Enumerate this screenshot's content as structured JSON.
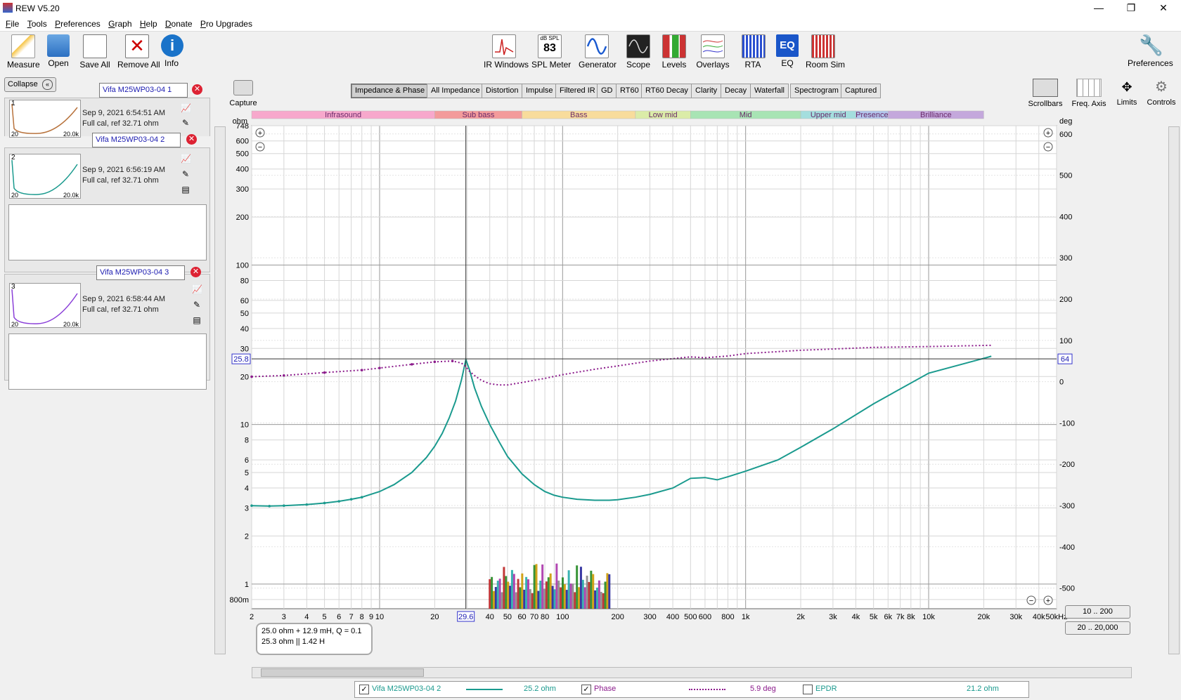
{
  "window": {
    "title": "REW V5.20",
    "minimize": "—",
    "maximize": "❐",
    "close": "✕"
  },
  "menu": [
    "File",
    "Tools",
    "Preferences",
    "Graph",
    "Help",
    "Donate",
    "Pro Upgrades"
  ],
  "toolbar_left": [
    {
      "label": "Measure",
      "icon": "measure-icon"
    },
    {
      "label": "Open",
      "icon": "folder-icon"
    },
    {
      "label": "Save All",
      "icon": "save-icon"
    },
    {
      "label": "Remove All",
      "icon": "remove-icon"
    },
    {
      "label": "Info",
      "icon": "info-icon"
    }
  ],
  "toolbar_center": [
    {
      "label": "IR Windows"
    },
    {
      "label": "SPL Meter",
      "display_top": "dB SPL",
      "display_value": "83"
    },
    {
      "label": "Generator"
    },
    {
      "label": "Scope"
    },
    {
      "label": "Levels"
    },
    {
      "label": "Overlays"
    },
    {
      "label": "RTA"
    },
    {
      "label": "EQ",
      "display_value": "EQ"
    },
    {
      "label": "Room Sim"
    }
  ],
  "toolbar_right": {
    "label": "Preferences"
  },
  "collapse": {
    "label": "Collapse",
    "icon": "«"
  },
  "measurements": [
    {
      "name": "Vifa M25WP03-04 1",
      "index": "1",
      "date": "Sep 9, 2021 6:54:51 AM",
      "cal": "Full cal, ref 32.71 ohm",
      "thumb_lo": "20",
      "thumb_hi": "20.0k",
      "color": "#b8733d"
    },
    {
      "name": "Vifa M25WP03-04 2",
      "index": "2",
      "date": "Sep 9, 2021 6:56:19 AM",
      "cal": "Full cal, ref 32.71 ohm",
      "thumb_lo": "20",
      "thumb_hi": "20.0k",
      "color": "#1a9a8e"
    },
    {
      "name": "Vifa M25WP03-04 3",
      "index": "3",
      "date": "Sep 9, 2021 6:58:44 AM",
      "cal": "Full cal, ref 32.71 ohm",
      "thumb_lo": "20",
      "thumb_hi": "20.0k",
      "color": "#8a3fd8"
    }
  ],
  "capture": {
    "label": "Capture"
  },
  "graph_tabs": [
    "Impedance & Phase",
    "All Impedance",
    "Distortion",
    "Impulse",
    "Filtered IR",
    "GD",
    "RT60",
    "RT60 Decay",
    "Clarity",
    "Decay",
    "Waterfall",
    "Spectrogram",
    "Captured"
  ],
  "selected_tab": "Impedance & Phase",
  "right_tools": [
    {
      "label": "Scrollbars"
    },
    {
      "label": "Freq. Axis"
    },
    {
      "label": "Limits"
    },
    {
      "label": "Controls"
    }
  ],
  "bands": [
    {
      "name": "Infrasound",
      "from": 2,
      "to": 20,
      "color": "#f7a8cc"
    },
    {
      "name": "Sub bass",
      "from": 20,
      "to": 60,
      "color": "#f39b9b"
    },
    {
      "name": "Bass",
      "from": 60,
      "to": 250,
      "color": "#f8dc9c"
    },
    {
      "name": "Low mid",
      "from": 250,
      "to": 500,
      "color": "#dbeca8"
    },
    {
      "name": "Mid",
      "from": 500,
      "to": 2000,
      "color": "#a8e4b4"
    },
    {
      "name": "Upper mid",
      "from": 2000,
      "to": 4000,
      "color": "#a4dede"
    },
    {
      "name": "Presence",
      "from": 4000,
      "to": 6000,
      "color": "#b3c7ec"
    },
    {
      "name": "Brilliance",
      "from": 6000,
      "to": 20000,
      "color": "#c4a8dc"
    }
  ],
  "readouts": {
    "left_value": "25.8",
    "right_value": "64",
    "cursor_freq": "29.6"
  },
  "model_box": {
    "line1": "25.0 ohm + 12.9 mH, Q = 0.1",
    "line2": "25.3 ohm || 1.42 H"
  },
  "range_buttons": [
    "10 .. 200",
    "20 .. 20,000"
  ],
  "legend": {
    "trace_name": "Vifa M25WP03-04 2",
    "trace_value": "25.2 ohm",
    "phase_label": "Phase",
    "phase_value": "5.9 deg",
    "epdr_label": "EPDR",
    "epdr_value": "21.2 ohm"
  },
  "chart_data": {
    "type": "line",
    "xlabel": "",
    "ylabel_left": "ohm",
    "ylabel_right": "deg",
    "x_scale": "log",
    "xlim": [
      2,
      50000
    ],
    "ylim_left": [
      0.7,
      748
    ],
    "y_left_scale": "log",
    "ylim_right": [
      -550,
      620
    ],
    "grid": true,
    "x_ticks": [
      "2",
      "3",
      "4",
      "5",
      "6",
      "7",
      "8",
      "9",
      "10",
      "20",
      "30",
      "40",
      "50",
      "60",
      "70",
      "80",
      "100",
      "200",
      "300",
      "400",
      "500",
      "600",
      "800",
      "1k",
      "2k",
      "3k",
      "4k",
      "5k",
      "6k",
      "7k",
      "8k",
      "10k",
      "20k",
      "30k",
      "40k",
      "50kHz"
    ],
    "x_tick_values": [
      2,
      3,
      4,
      5,
      6,
      7,
      8,
      9,
      10,
      20,
      30,
      40,
      50,
      60,
      70,
      80,
      100,
      200,
      300,
      400,
      500,
      600,
      800,
      1000,
      2000,
      3000,
      4000,
      5000,
      6000,
      7000,
      8000,
      10000,
      20000,
      30000,
      40000,
      50000
    ],
    "y_left_ticks": [
      "748",
      "600",
      "500",
      "400",
      "300",
      "200",
      "100",
      "80",
      "60",
      "50",
      "40",
      "30",
      "20",
      "10",
      "8",
      "6",
      "5",
      "4",
      "3",
      "2",
      "1",
      "800m"
    ],
    "y_left_tick_values": [
      748,
      600,
      500,
      400,
      300,
      200,
      100,
      80,
      60,
      50,
      40,
      30,
      20,
      10,
      8,
      6,
      5,
      4,
      3,
      2,
      1,
      0.8
    ],
    "y_right_ticks": [
      "600",
      "500",
      "400",
      "300",
      "200",
      "100",
      "0",
      "-100",
      "-200",
      "-300",
      "-400",
      "-500"
    ],
    "y_right_tick_values": [
      600,
      500,
      400,
      300,
      200,
      100,
      0,
      -100,
      -200,
      -300,
      -400,
      -500
    ],
    "series": [
      {
        "name": "Vifa M25WP03-04 2",
        "axis": "left",
        "color": "#1a9a8e",
        "x": [
          2,
          2.5,
          3,
          4,
          5,
          6,
          7,
          8,
          10,
          12,
          15,
          18,
          20,
          22,
          24,
          26,
          28,
          29.6,
          31,
          33,
          36,
          40,
          45,
          50,
          60,
          70,
          80,
          90,
          100,
          120,
          150,
          180,
          200,
          250,
          300,
          400,
          500,
          600,
          700,
          800,
          1000,
          1500,
          2000,
          3000,
          5000,
          10000,
          20000,
          22000
        ],
        "y": [
          3.1,
          3.08,
          3.1,
          3.15,
          3.22,
          3.3,
          3.4,
          3.5,
          3.8,
          4.2,
          5.0,
          6.2,
          7.3,
          8.8,
          11,
          14,
          19,
          25.5,
          22,
          17,
          13,
          10,
          7.8,
          6.3,
          4.9,
          4.2,
          3.8,
          3.6,
          3.5,
          3.4,
          3.35,
          3.35,
          3.38,
          3.5,
          3.65,
          4.0,
          4.6,
          4.65,
          4.5,
          4.7,
          5.1,
          6.0,
          7.2,
          9.4,
          13.5,
          21.0,
          26.0,
          26.8
        ]
      },
      {
        "name": "Phase",
        "axis": "right",
        "color": "#8b1a8b",
        "x": [
          2,
          3,
          5,
          8,
          10,
          15,
          20,
          25,
          28,
          29.6,
          31,
          33,
          36,
          40,
          45,
          50,
          60,
          80,
          100,
          150,
          200,
          300,
          500,
          600,
          800,
          1000,
          2000,
          5000,
          10000,
          22000
        ],
        "y": [
          12,
          15,
          22,
          28,
          33,
          42,
          48,
          50,
          45,
          36,
          25,
          15,
          3,
          -5,
          -8,
          -8,
          -2,
          8,
          17,
          30,
          38,
          50,
          60,
          58,
          62,
          68,
          76,
          83,
          85,
          88
        ]
      }
    ],
    "bars_region": {
      "from": 40,
      "to": 180,
      "colors": [
        "#b22",
        "#282",
        "#c90",
        "#229",
        "#2aa",
        "#a3a",
        "#888"
      ]
    }
  }
}
